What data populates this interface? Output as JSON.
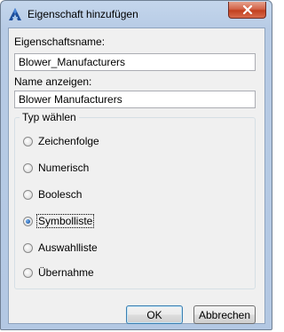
{
  "window": {
    "title": "Eigenschaft hinzufügen",
    "app_icon": "autocad-a-icon",
    "close_icon": "close-x-icon"
  },
  "fields": {
    "property_name_label": "Eigenschaftsname:",
    "property_name_value": "Blower_Manufacturers",
    "display_name_label": "Name anzeigen:",
    "display_name_value": "Blower Manufacturers"
  },
  "type_group": {
    "legend": "Typ wählen",
    "options": [
      {
        "label": "Zeichenfolge",
        "checked": false
      },
      {
        "label": "Numerisch",
        "checked": false
      },
      {
        "label": "Boolesch",
        "checked": false
      },
      {
        "label": "Symbolliste",
        "checked": true
      },
      {
        "label": "Auswahlliste",
        "checked": false
      },
      {
        "label": "Übernahme",
        "checked": false
      }
    ]
  },
  "buttons": {
    "ok_label": "OK",
    "cancel_label": "Abbrechen"
  },
  "colors": {
    "title_bar": "#b7cbe5",
    "client_bg": "#f0f0f0",
    "close_button": "#c2401f",
    "radio_dot": "#1f5fb0"
  }
}
